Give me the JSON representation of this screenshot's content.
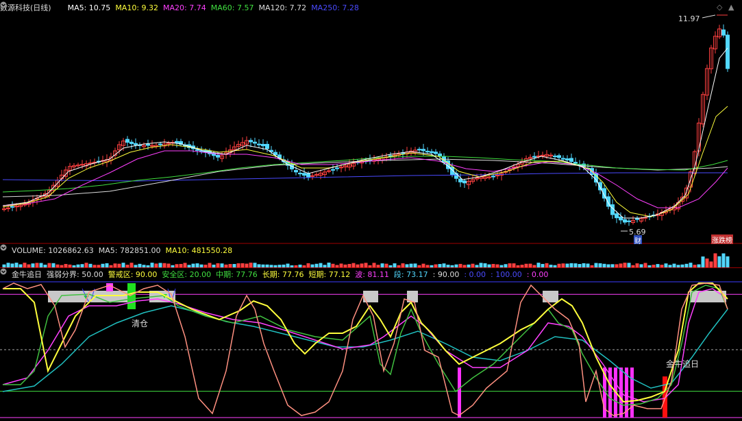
{
  "main": {
    "title": "数源科技(日线)",
    "ma": [
      {
        "label": "MA5: 10.75",
        "color": "#ffffff"
      },
      {
        "label": "MA10: 9.32",
        "color": "#ffff3c"
      },
      {
        "label": "MA20: 7.74",
        "color": "#ff40ff"
      },
      {
        "label": "MA60: 7.57",
        "color": "#40e040"
      },
      {
        "label": "MA120: 7.72",
        "color": "#dddddd"
      },
      {
        "label": "MA250: 7.28",
        "color": "#4a4aff"
      }
    ],
    "high_label": "11.97",
    "low_label": "5.69",
    "cai_badge": "财",
    "zhangting_badge": "涨跌榜",
    "colors": {
      "up": "#ff4040",
      "down": "#52d8ff",
      "ma5": "#ffffff",
      "ma10": "#ffff3c",
      "ma20": "#ff40ff",
      "ma60": "#40e040",
      "ma250": "#4a4aff"
    }
  },
  "volume": {
    "labels": [
      {
        "label": "VOLUME: 1026862.63",
        "color": "#dddddd"
      },
      {
        "label": "MA5: 782851.00",
        "color": "#dddddd"
      },
      {
        "label": "MA10: 481550.28",
        "color": "#ffff3c"
      }
    ]
  },
  "indicator": {
    "title": "金牛追日",
    "params": [
      {
        "label": "强弱分界: 50.00",
        "color": "#dddddd"
      },
      {
        "label": "警戒区: 90.00",
        "color": "#ffff3c"
      },
      {
        "label": "安全区: 20.00",
        "color": "#40e040"
      },
      {
        "label": "中期: 77.76",
        "color": "#40e040"
      },
      {
        "label": "长期: 77.76",
        "color": "#ffff3c"
      },
      {
        "label": "短期: 77.12",
        "color": "#ffff3c"
      },
      {
        "label": "波: 81.11",
        "color": "#ff40ff"
      },
      {
        "label": "段: 73.17",
        "color": "#52d8ff"
      },
      {
        "label": ": 90.00",
        "color": "#dddddd"
      },
      {
        "label": ": 0.00",
        "color": "#4a4aff"
      },
      {
        "label": ": 100.00",
        "color": "#4a4aff"
      },
      {
        "label": ": 0.00",
        "color": "#ff40ff"
      }
    ],
    "qingcang_label": "清仓",
    "jinniu_label": "金牛追日"
  }
}
